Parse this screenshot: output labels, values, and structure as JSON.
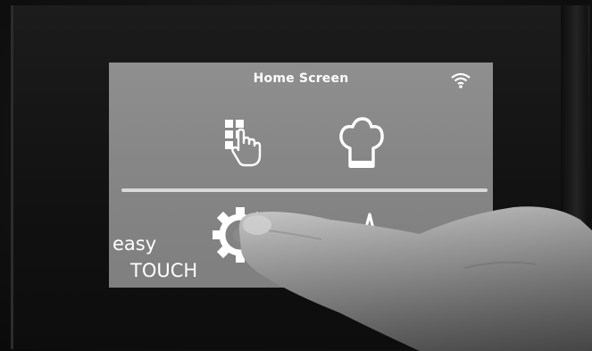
{
  "screen": {
    "title": "Home Screen",
    "status_icon": "wifi-icon",
    "tiles": [
      {
        "id": "apps",
        "icon": "grid-touch-icon"
      },
      {
        "id": "cooking",
        "icon": "chef-hat-icon"
      },
      {
        "id": "settings",
        "icon": "gear-icon"
      },
      {
        "id": "graph",
        "icon": "temperature-graph-icon"
      }
    ]
  },
  "brand": {
    "line1": "easy",
    "line2": "TOUCH"
  },
  "colors": {
    "screen": "#878787",
    "bezel": "#141414",
    "icon": "#ffffff"
  }
}
